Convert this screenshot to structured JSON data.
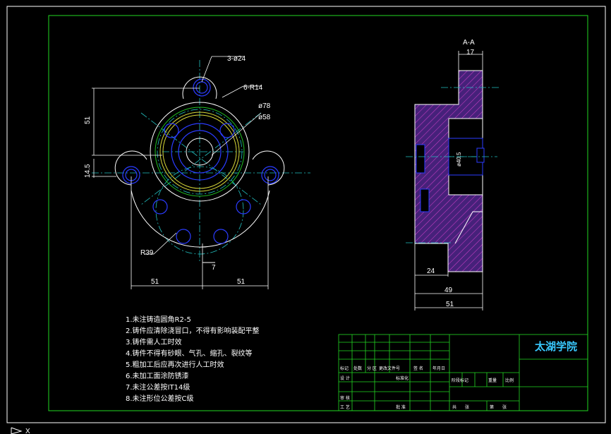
{
  "drawing": {
    "section_label": "A-A",
    "dims": {
      "holes": "3-ø24",
      "radius_r14": "6-R14",
      "dia78": "ø78",
      "dia58": "ø58",
      "d51_vertical": "51",
      "d14_5": "14.5",
      "r39": "R39",
      "d7": "7",
      "d51_left": "51",
      "d51_right": "51",
      "sect_top": "17",
      "sect_bore": "ø40.5",
      "sect_24": "24",
      "sect_49": "49",
      "sect_51": "51"
    },
    "notes": [
      "1.未注铸造圆角R2-5",
      "2.铸件应清除浇冒口，不得有影响装配平整",
      "3.铸件需人工时效",
      "4.铸件不得有砂眼、气孔、缩孔、裂纹等",
      "5.粗加工后应再次进行人工时效",
      "6.未加工面涂防锈漆",
      "7.未注公差按IT14级",
      "8.未注形位公差按C级"
    ]
  },
  "title_block": {
    "school": "太湖学院",
    "labels": {
      "mark": "标记",
      "count": "处数",
      "zone": "分 区",
      "doc_no": "更改文件号",
      "sign": "签 名",
      "date": "年月日",
      "designer": "设 计",
      "standard": "标准化",
      "review": "审 核",
      "process": "工 艺",
      "approve": "批 准",
      "stage_mark": "阶段标记",
      "weight": "重量",
      "scale": "比例",
      "sheets": "共　　张",
      "sheet_no": "第　　张"
    }
  },
  "ucs": {
    "x_label": "X"
  }
}
